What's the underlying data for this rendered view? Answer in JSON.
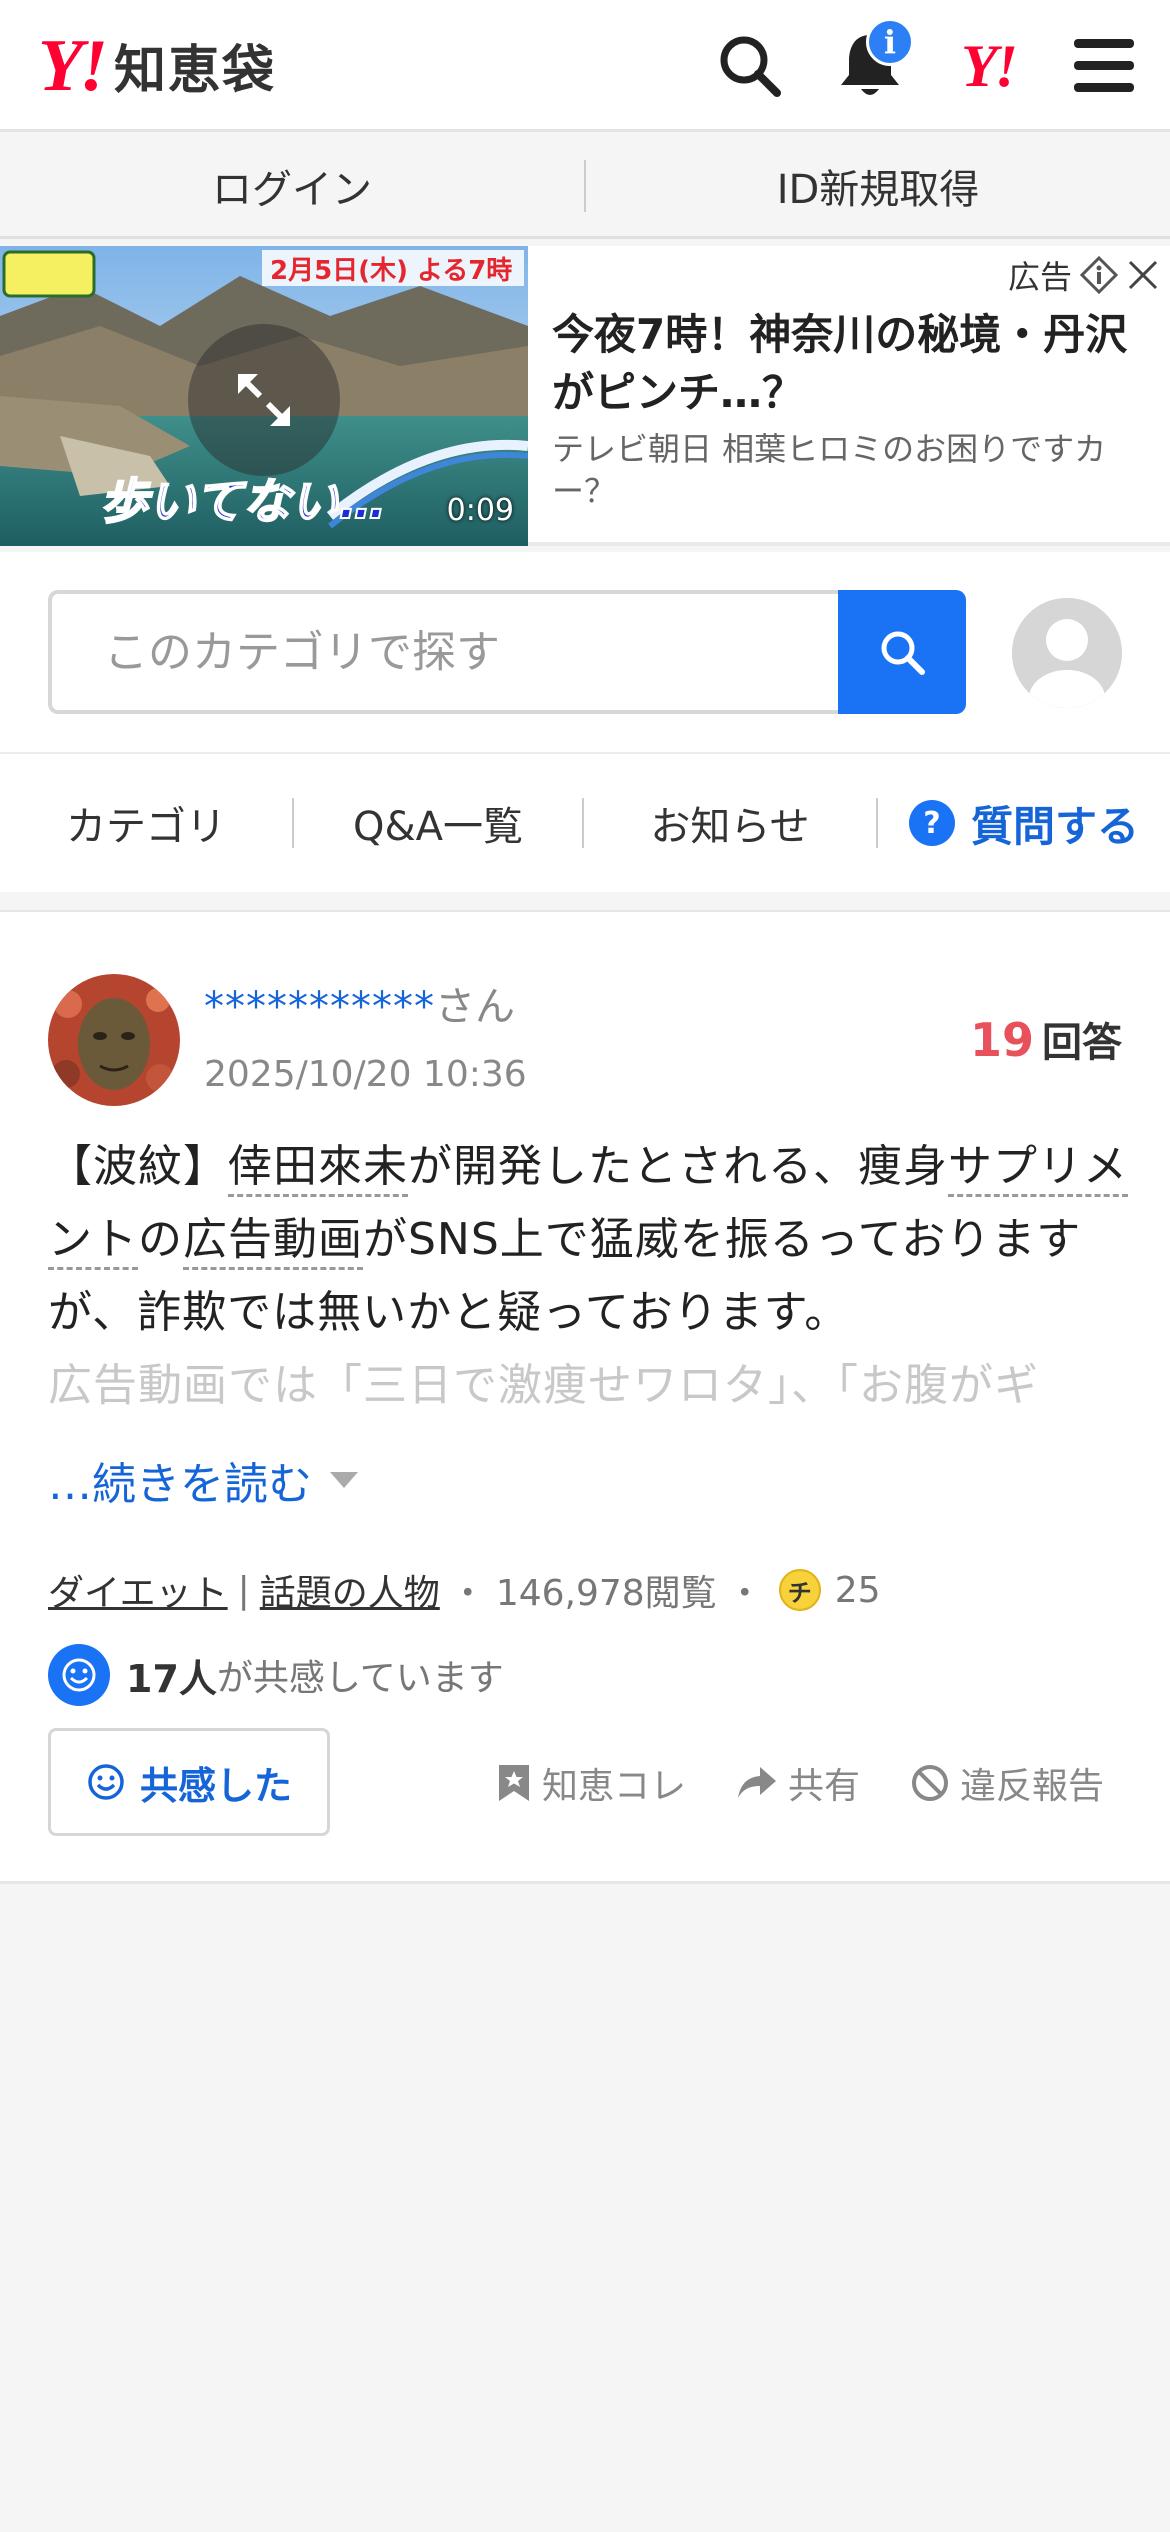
{
  "header": {
    "logo_mark": "Y!",
    "logo_text": "知恵袋",
    "notification_badge": "i",
    "yahoo_mini": "Y!",
    "icons": [
      "search-icon",
      "bell-icon",
      "yahoo-icon",
      "menu-icon"
    ]
  },
  "auth": {
    "login": "ログイン",
    "register": "ID新規取得"
  },
  "ad": {
    "label": "広告",
    "title": "今夜7時！神奈川の秘境・丹沢がピンチ…？",
    "source": "テレビ朝日 相葉ヒロミのお困りですカー？",
    "thumb_date": "2月5日(木) よる7時",
    "thumb_caption": "歩いてない…",
    "duration": "0:09"
  },
  "search": {
    "placeholder": "このカテゴリで探す"
  },
  "nav": {
    "category": "カテゴリ",
    "qa_list": "Q&A一覧",
    "news": "お知らせ",
    "ask": "質問する"
  },
  "question": {
    "user_name": "***********",
    "user_suffix": "さん",
    "date": "2025/10/20 10:36",
    "answer_count": "19",
    "answer_label": "回答",
    "body": {
      "p1": "【波紋】",
      "k1": "倖田來未",
      "p2": "が開発したとされる、痩身",
      "k2": "サプリメント",
      "p3": "の",
      "k3": "広告動画",
      "p4": "がSNS上で猛威を振るっておりますが、詐欺では無いかと疑っております。"
    },
    "faded_line": "広告動画では「三日で激痩せワロタ」、「お腹がギ",
    "read_more": "…続きを読む",
    "category_1": "ダイエット",
    "category_sep": "|",
    "category_2": "話題の人物",
    "views": "146,978閲覧",
    "coin_symbol": "チ",
    "coins": "25",
    "empathy_count": "17人",
    "empathy_text": "が共感しています",
    "empathy_button": "共感した",
    "action_save": "知恵コレ",
    "action_share": "共有",
    "action_report": "違反報告"
  },
  "colors": {
    "brand_red": "#ff0033",
    "accent_blue": "#1a73f5",
    "link_blue": "#1565d8",
    "answer_red": "#e8505b"
  }
}
